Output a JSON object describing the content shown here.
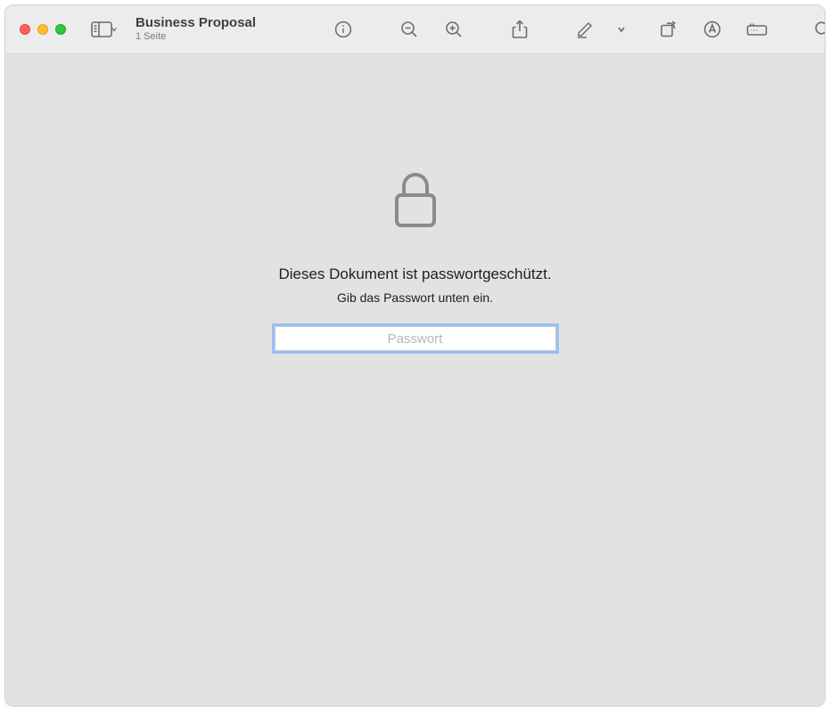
{
  "document": {
    "title": "Business Proposal",
    "subtitle": "1 Seite"
  },
  "lock": {
    "message": "Dieses Dokument ist passwortgeschützt.",
    "instruction": "Gib das Passwort unten ein.",
    "placeholder": "Passwort"
  }
}
